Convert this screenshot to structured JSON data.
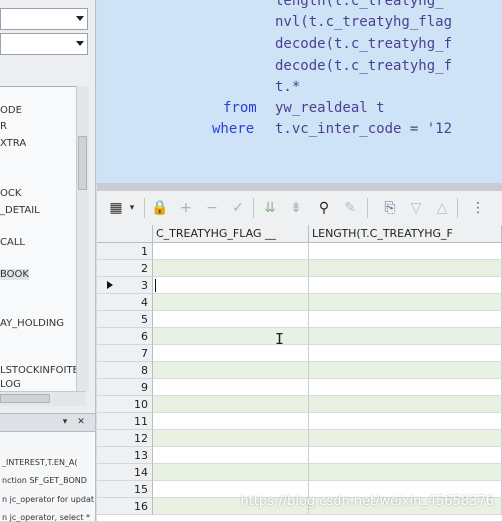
{
  "left_panel": {
    "combo1_value": "",
    "combo2_value": "",
    "objects": [
      "ODE",
      "R",
      "XTRA",
      "OCK",
      "_DETAIL",
      "CALL",
      "BOOK",
      "AY_HOLDING",
      "LSTOCKINFOITE",
      "LOG"
    ],
    "snippets": [
      "_INTEREST,T.EN_A(",
      "nction SF_GET_BOND",
      "n jc_operator for updat",
      "n jc_operator, select *"
    ],
    "panel_buttons": [
      "▾",
      "✕"
    ]
  },
  "editor": {
    "lines": [
      {
        "text": "length(t.c_treatyhg_"
      },
      {
        "text": "nvl(t.c_treatyhg_flag"
      },
      {
        "text": "decode(t.c_treatyhg_f"
      },
      {
        "text": "decode(t.c_treatyhg_f"
      },
      {
        "text": "t.*"
      },
      {
        "kw": "from",
        "text": "yw_realdeal t"
      },
      {
        "kw": "where",
        "text": "t.vc_inter_code = '12"
      }
    ]
  },
  "toolbar": {
    "icons": [
      "grid-icon",
      "dropdown-icon",
      "lock-icon",
      "add-icon",
      "remove-icon",
      "check-icon",
      "fetch-next-icon",
      "fetch-all-icon",
      "find-icon",
      "clear-icon",
      "export-icon",
      "sort-desc-icon",
      "sort-asc-icon",
      "tree-icon"
    ]
  },
  "grid": {
    "columns": [
      "C_TREATYHG_FLAG __",
      "LENGTH(T.C_TREATYHG_F"
    ],
    "rows": [
      "1",
      "2",
      "3",
      "4",
      "5",
      "6",
      "7",
      "8",
      "9",
      "10",
      "11",
      "12",
      "13",
      "14",
      "15",
      "16"
    ],
    "current_row_index": 2
  },
  "watermark": "https://blog.csdn.net/weixin_45658376"
}
